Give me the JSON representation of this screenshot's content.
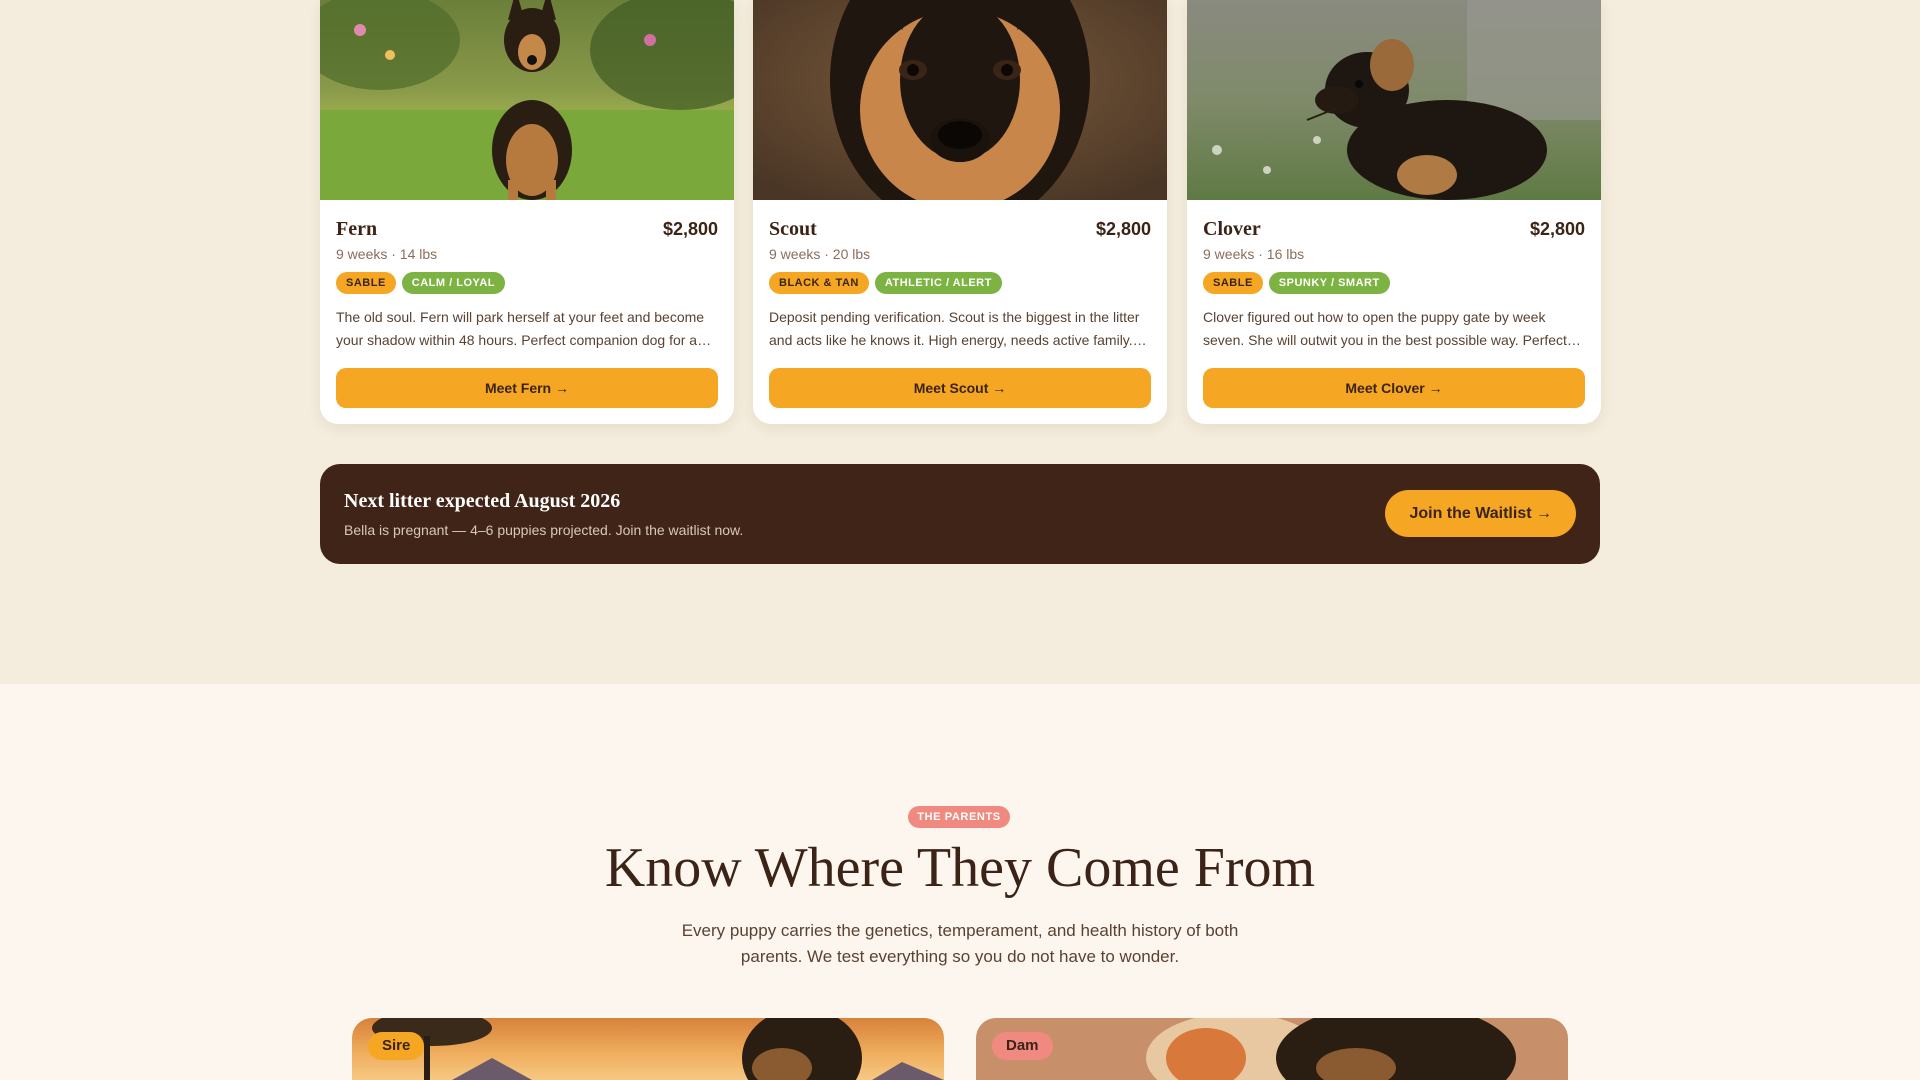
{
  "puppies": [
    {
      "name": "Fern",
      "price": "$2,800",
      "meta": "9 weeks · 14 lbs",
      "tags": [
        "SABLE",
        "CALM / LOYAL"
      ],
      "description": "The old soul. Fern will park herself at your feet and become your shadow within 48 hours. Perfect companion dog for a…",
      "button": "Meet Fern →",
      "photo_alt": "German Shepherd puppy sitting on grass in a garden"
    },
    {
      "name": "Scout",
      "price": "$2,800",
      "meta": "9 weeks · 20 lbs",
      "tags": [
        "BLACK & TAN",
        "ATHLETIC / ALERT"
      ],
      "description": "Deposit pending verification. Scout is the biggest in the litter and acts like he knows it. High energy, needs active family.…",
      "button": "Meet Scout →",
      "photo_alt": "Close-up of a German Shepherd puppy face"
    },
    {
      "name": "Clover",
      "price": "$2,800",
      "meta": "9 weeks · 16 lbs",
      "tags": [
        "SABLE",
        "SPUNKY / SMART"
      ],
      "description": "Clover figured out how to open the puppy gate by week seven. She will outwit you in the best possible way. Perfect…",
      "button": "Meet Clover →",
      "photo_alt": "Black and tan German Shepherd puppy in profile"
    }
  ],
  "banner": {
    "title": "Next litter expected August 2026",
    "subtitle": "Bella is pregnant — 4–6 puppies projected. Join the waitlist now.",
    "button": "Join the Waitlist →"
  },
  "parents": {
    "eyebrow": "THE PARENTS",
    "title": "Know Where They Come From",
    "subtitle": "Every puppy carries the genetics, temperament, and health history of both parents. We test everything so you do not have to wonder.",
    "sire_label": "Sire",
    "dam_label": "Dam"
  },
  "colors": {
    "accent": "#f5a623",
    "secondary_tag": "#7cb342",
    "banner_bg": "#3f2417",
    "eyebrow": "#f08a80",
    "text_dark": "#3b2417"
  }
}
